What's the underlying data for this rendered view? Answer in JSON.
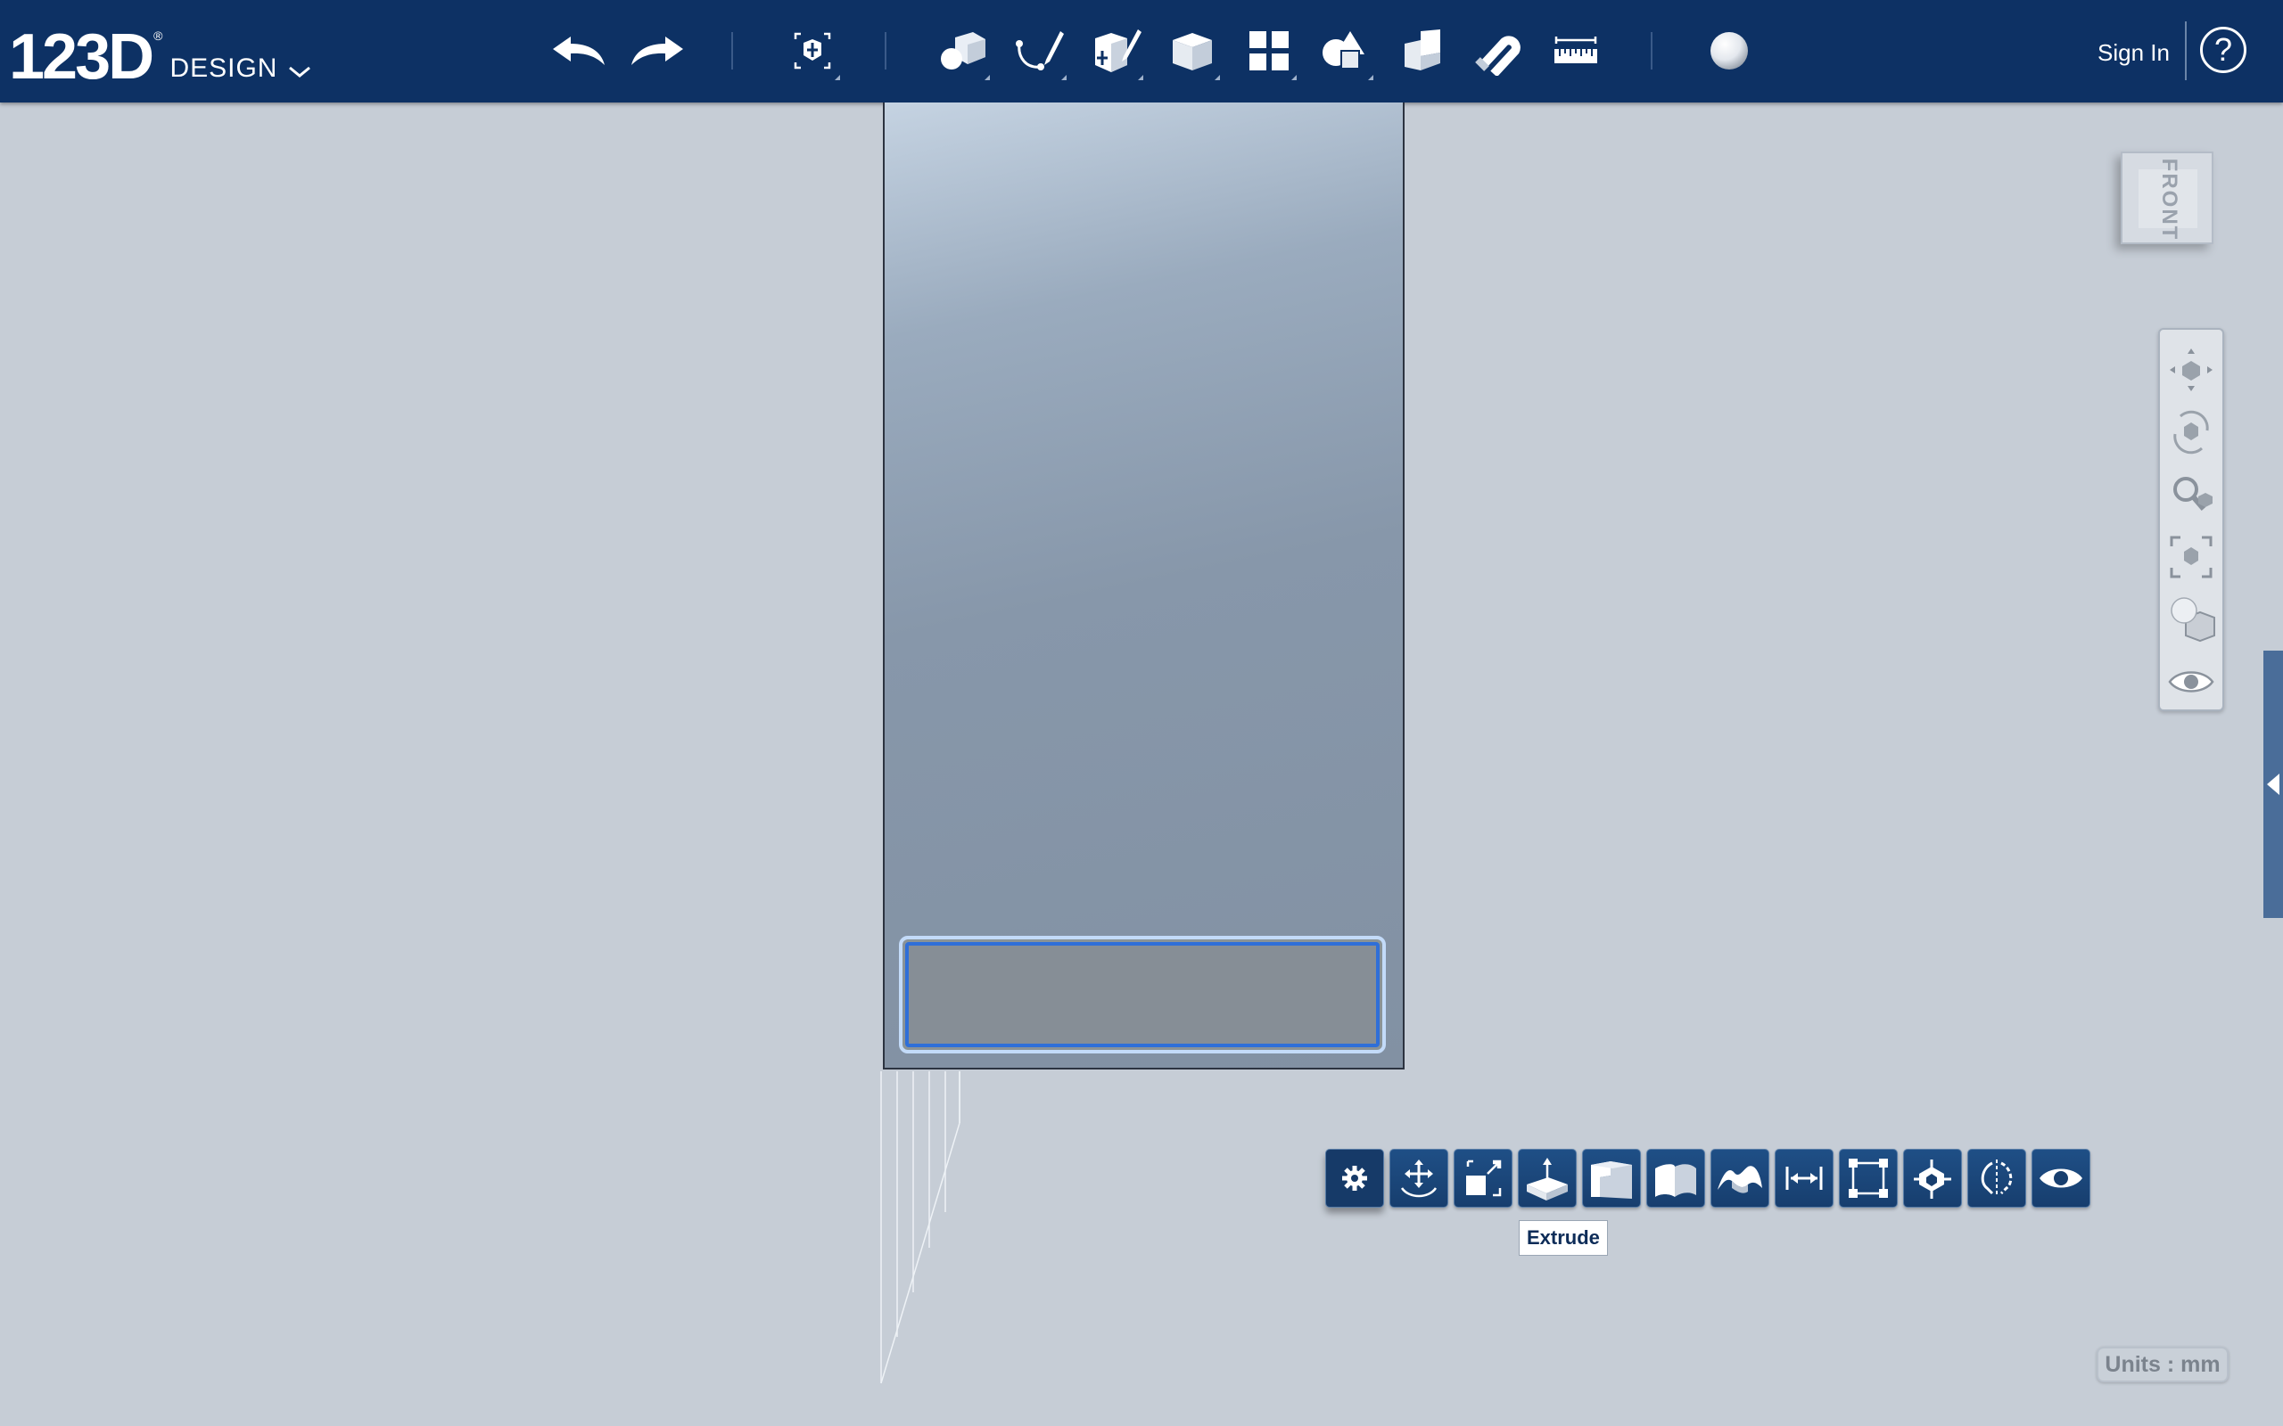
{
  "app": {
    "logo_number": "123D",
    "logo_registered": "®",
    "logo_word": "DESIGN"
  },
  "toolbar": {
    "sign_in_label": "Sign In",
    "help_label": "?",
    "icons": [
      "undo-icon",
      "redo-icon",
      "transform-icon",
      "primitives-icon",
      "sketch-icon",
      "construct-icon",
      "modify-icon",
      "pattern-icon",
      "grouping-icon",
      "combine-icon",
      "snap-icon",
      "measure-icon",
      "material-icon"
    ]
  },
  "viewcube": {
    "face_label": "FRONT"
  },
  "navbar": {
    "icons": [
      "pan-icon",
      "orbit-icon",
      "zoom-icon",
      "fit-icon",
      "view-mode-icon",
      "visibility-icon"
    ]
  },
  "context_toolbar": {
    "icons": [
      "settings-icon",
      "move-icon",
      "scale-icon",
      "extrude-icon",
      "sweep-icon",
      "loft-icon",
      "surface-icon",
      "dimension-icon",
      "bounding-box-icon",
      "combine-icon",
      "mirror-icon",
      "hide-icon"
    ],
    "tooltip": "Extrude"
  },
  "units": {
    "label": "Units : mm"
  },
  "colors": {
    "toolbar_bg": "#0d3164",
    "canvas_bg": "#c6cdd6",
    "selection_border": "#2f6fd8"
  }
}
